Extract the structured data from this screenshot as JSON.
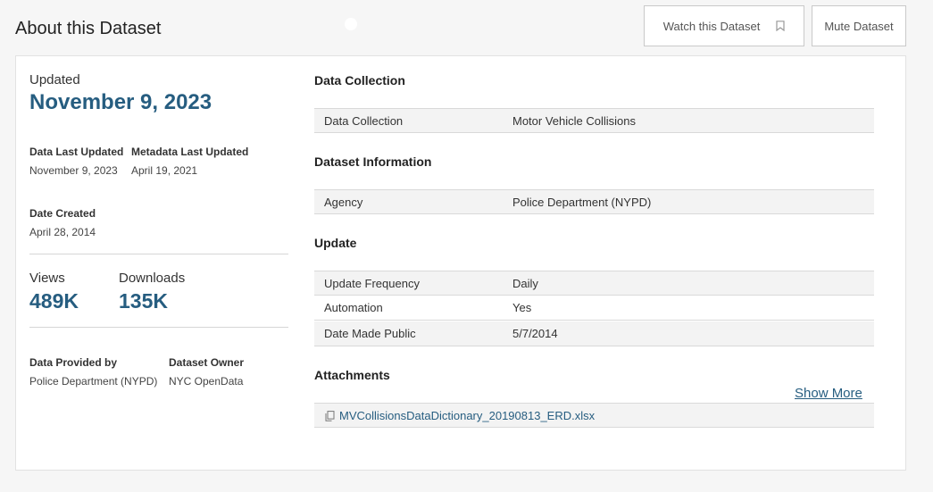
{
  "page": {
    "title": "About this Dataset"
  },
  "actions": {
    "watch_label": "Watch this Dataset",
    "mute_label": "Mute Dataset",
    "watch_icon": "bookmark-icon"
  },
  "summary": {
    "updated_label": "Updated",
    "updated_value": "November 9, 2023",
    "data_last_updated_label": "Data Last Updated",
    "data_last_updated_value": "November 9, 2023",
    "metadata_last_updated_label": "Metadata Last Updated",
    "metadata_last_updated_value": "April 19, 2021",
    "date_created_label": "Date Created",
    "date_created_value": "April 28, 2014",
    "views_label": "Views",
    "views_value": "489K",
    "downloads_label": "Downloads",
    "downloads_value": "135K",
    "provided_by_label": "Data Provided by",
    "provided_by_value": "Police Department (NYPD)",
    "owner_label": "Dataset Owner",
    "owner_value": "NYC OpenData"
  },
  "sections": {
    "collection": {
      "title": "Data Collection",
      "rows": [
        {
          "key": "Data Collection",
          "value": "Motor Vehicle Collisions"
        }
      ]
    },
    "info": {
      "title": "Dataset Information",
      "rows": [
        {
          "key": "Agency",
          "value": "Police Department (NYPD)"
        }
      ]
    },
    "update": {
      "title": "Update",
      "rows": [
        {
          "key": "Update Frequency",
          "value": "Daily"
        },
        {
          "key": "Automation",
          "value": "Yes"
        },
        {
          "key": "Date Made Public",
          "value": "5/7/2014"
        }
      ]
    },
    "attachments": {
      "title": "Attachments",
      "files": [
        {
          "name": "MVCollisionsDataDictionary_20190813_ERD.xlsx",
          "icon": "document-icon"
        }
      ]
    }
  },
  "show_more_label": "Show More",
  "colors": {
    "accent": "#265d80",
    "row_shade": "#f3f3f3",
    "background": "#f6f6f6"
  }
}
